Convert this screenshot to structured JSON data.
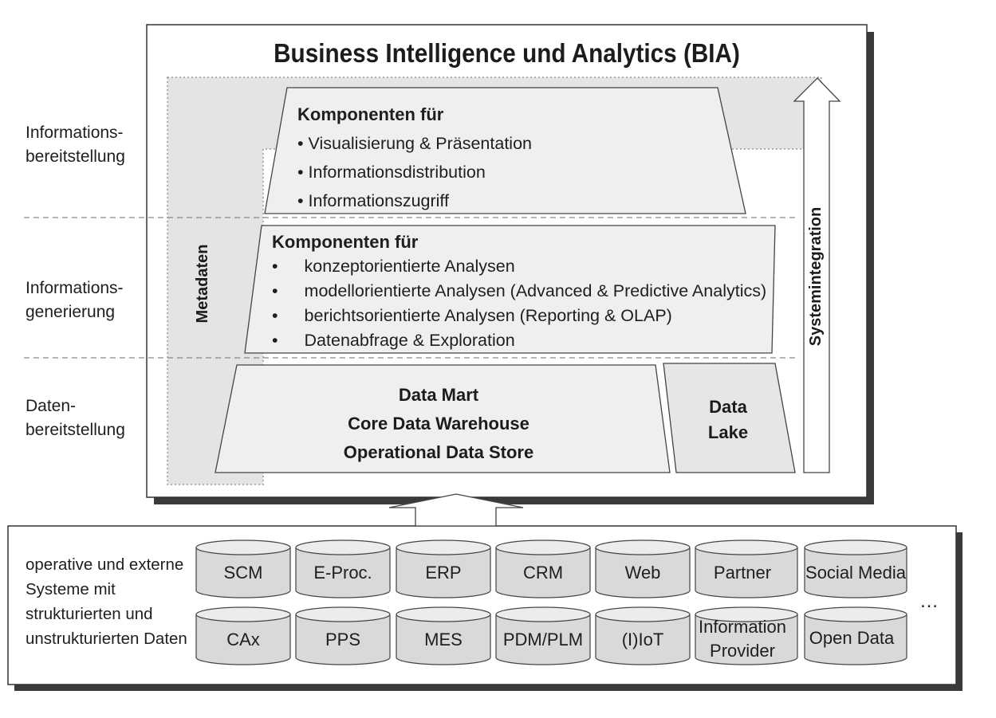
{
  "title": "Business Intelligence und Analytics (BIA)",
  "layers": {
    "informationsbereitstellung": [
      "Informations-",
      "bereitstellung"
    ],
    "informationsgenerierung": [
      "Informations-",
      "generierung"
    ],
    "datenbereitstellung": [
      "Daten-",
      "bereitstellung"
    ]
  },
  "metadaten": "Metadaten",
  "systemintegration": "Systemintegration",
  "top_box": {
    "heading": "Komponenten für",
    "items": [
      "Visualisierung & Präsentation",
      "Informationsdistribution",
      "Informationszugriff"
    ]
  },
  "middle_box": {
    "heading": "Komponenten für",
    "items": [
      "konzeptorientierte Analysen",
      "modellorientierte Analysen (Advanced & Predictive Analytics)",
      "berichtsorientierte Analysen (Reporting & OLAP)",
      "Datenabfrage & Exploration"
    ]
  },
  "data_box": {
    "lines": [
      "Data Mart",
      "Core Data Warehouse",
      "Operational Data Store"
    ]
  },
  "data_lake": {
    "lines": [
      "Data",
      "Lake"
    ]
  },
  "sources": {
    "description": [
      "operative und externe",
      "Systeme mit",
      "strukturierten und",
      "unstrukturierten Daten"
    ],
    "row1": [
      "SCM",
      "E-Proc.",
      "ERP",
      "CRM",
      "Web",
      "Partner",
      "Social Media"
    ],
    "row2": [
      "CAx",
      "PPS",
      "MES",
      "PDM/PLM",
      "(I)IoT",
      "Information Provider",
      "Open Data"
    ],
    "more": "…"
  }
}
